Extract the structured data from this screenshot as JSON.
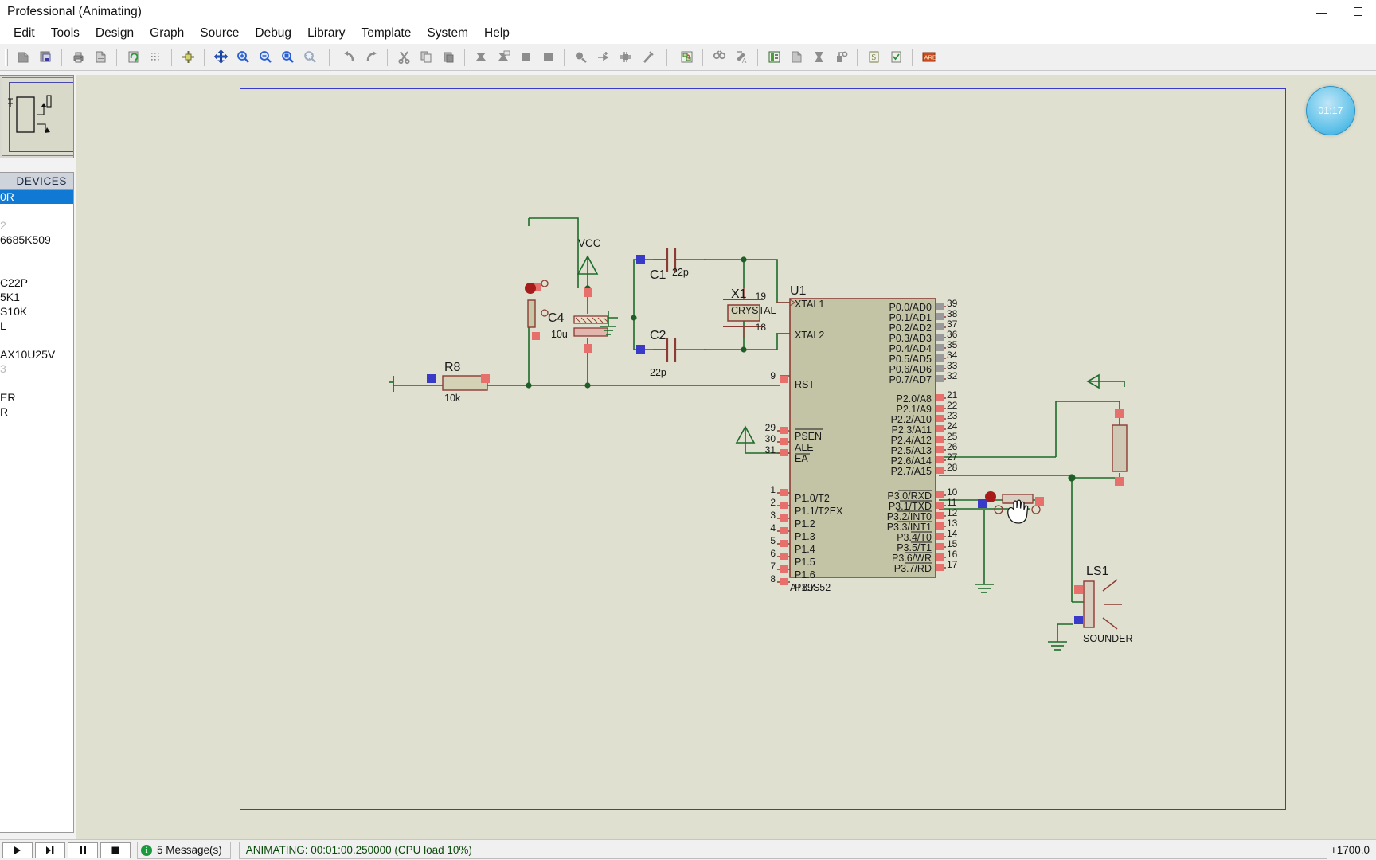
{
  "window": {
    "title": "Professional (Animating)",
    "controls": {
      "minimize": "minimize-icon",
      "maximize": "maximize-icon"
    }
  },
  "menubar": {
    "items": [
      {
        "label": "Edit"
      },
      {
        "label": "Tools"
      },
      {
        "label": "Design"
      },
      {
        "label": "Graph"
      },
      {
        "label": "Source"
      },
      {
        "label": "Debug"
      },
      {
        "label": "Library"
      },
      {
        "label": "Template"
      },
      {
        "label": "System"
      },
      {
        "label": "Help"
      }
    ]
  },
  "toolbar": {
    "groups": [
      [
        "new-sheet-icon",
        "open-design-icon"
      ],
      [
        "print-icon",
        "print-area-icon"
      ],
      [
        "refresh-display-icon",
        "toggle-grid-icon"
      ],
      [
        "origin-icon"
      ],
      [
        "pan-icon",
        "zoom-in-icon",
        "zoom-out-icon",
        "zoom-area-icon",
        "zoom-sheet-icon"
      ],
      [
        "undo-icon",
        "redo-icon"
      ],
      [
        "cut-icon",
        "copy-icon",
        "paste-icon"
      ],
      [
        "block-copy-icon",
        "block-move-icon",
        "block-rotate-icon",
        "block-delete-icon"
      ],
      [
        "pick-device-icon",
        "make-device-icon",
        "packaging-tool-icon",
        "decompose-icon"
      ],
      [
        "wire-autorouter-icon"
      ],
      [
        "search-tag-icon",
        "property-assignment-icon"
      ],
      [
        "design-explorer-icon",
        "new-sheet-hier-icon",
        "remove-sheet-icon",
        "exit-sheet-icon"
      ],
      [
        "bill-of-materials-icon",
        "electrical-rule-check-icon"
      ],
      [
        "netlist-to-ares-icon"
      ]
    ]
  },
  "sidebar": {
    "overview": {
      "title": "overview-panel"
    },
    "devices": {
      "header": "DEVICES",
      "items": [
        {
          "label": "0R",
          "selected": true,
          "faint": false
        },
        {
          "label": "",
          "spacer": true
        },
        {
          "label": "2",
          "faint": true
        },
        {
          "label": "6685K509",
          "faint": false
        },
        {
          "label": "",
          "faint": true
        },
        {
          "label": "",
          "spacer": true
        },
        {
          "label": "C22P",
          "faint": false
        },
        {
          "label": "5K1",
          "faint": false
        },
        {
          "label": "S10K",
          "faint": false
        },
        {
          "label": "L",
          "faint": false
        },
        {
          "label": "",
          "spacer": true
        },
        {
          "label": "AX10U25V",
          "faint": false
        },
        {
          "label": "3",
          "faint": true
        },
        {
          "label": "",
          "spacer": true
        },
        {
          "label": "ER",
          "faint": false
        },
        {
          "label": "R",
          "faint": false
        }
      ]
    }
  },
  "canvas": {
    "simulation_clock": "01:17"
  },
  "schematic": {
    "power_labels": [
      {
        "name": "vcc-label",
        "text": "VCC"
      }
    ],
    "components": [
      {
        "ref": "R8",
        "value": "10k",
        "name": "resistor-r8"
      },
      {
        "ref": "C4",
        "value": "10u",
        "name": "capacitor-c4"
      },
      {
        "ref": "C1",
        "value": "22p",
        "name": "capacitor-c1"
      },
      {
        "ref": "C2",
        "value": "22p",
        "name": "capacitor-c2"
      },
      {
        "ref": "X1",
        "value": "CRYSTAL",
        "name": "crystal-x1"
      },
      {
        "ref": "U1",
        "value": "AT89S52",
        "name": "mcu-u1"
      },
      {
        "ref": "LS1",
        "value": "SOUNDER",
        "name": "sounder-ls1"
      }
    ],
    "mcu": {
      "ref": "U1",
      "part": "AT89S52",
      "left_pins": [
        {
          "num": "19",
          "label": "XTAL1"
        },
        {
          "num": "18",
          "label": "XTAL2"
        },
        {
          "num": "9",
          "label": "RST"
        },
        {
          "num": "29",
          "label": "PSEN"
        },
        {
          "num": "30",
          "label": "ALE"
        },
        {
          "num": "31",
          "label": "EA"
        },
        {
          "num": "1",
          "label": "P1.0/T2"
        },
        {
          "num": "2",
          "label": "P1.1/T2EX"
        },
        {
          "num": "3",
          "label": "P1.2"
        },
        {
          "num": "4",
          "label": "P1.3"
        },
        {
          "num": "5",
          "label": "P1.4"
        },
        {
          "num": "6",
          "label": "P1.5"
        },
        {
          "num": "7",
          "label": "P1.6"
        },
        {
          "num": "8",
          "label": "P1.7"
        }
      ],
      "right_pins_p0": [
        {
          "num": "39",
          "label": "P0.0/AD0"
        },
        {
          "num": "38",
          "label": "P0.1/AD1"
        },
        {
          "num": "37",
          "label": "P0.2/AD2"
        },
        {
          "num": "36",
          "label": "P0.3/AD3"
        },
        {
          "num": "35",
          "label": "P0.4/AD4"
        },
        {
          "num": "34",
          "label": "P0.5/AD5"
        },
        {
          "num": "33",
          "label": "P0.6/AD6"
        },
        {
          "num": "32",
          "label": "P0.7/AD7"
        }
      ],
      "right_pins_p2": [
        {
          "num": "21",
          "label": "P2.0/A8"
        },
        {
          "num": "22",
          "label": "P2.1/A9"
        },
        {
          "num": "23",
          "label": "P2.2/A10"
        },
        {
          "num": "24",
          "label": "P2.3/A11"
        },
        {
          "num": "25",
          "label": "P2.4/A12"
        },
        {
          "num": "26",
          "label": "P2.5/A13"
        },
        {
          "num": "27",
          "label": "P2.6/A14"
        },
        {
          "num": "28",
          "label": "P2.7/A15"
        }
      ],
      "right_pins_p3": [
        {
          "num": "10",
          "label": "P3.0/RXD"
        },
        {
          "num": "11",
          "label": "P3.1/TXD"
        },
        {
          "num": "12",
          "label": "P3.2/INT0"
        },
        {
          "num": "13",
          "label": "P3.3/INT1"
        },
        {
          "num": "14",
          "label": "P3.4/T0"
        },
        {
          "num": "15",
          "label": "P3.5/T1"
        },
        {
          "num": "16",
          "label": "P3.6/WR"
        },
        {
          "num": "17",
          "label": "P3.7/RD"
        }
      ]
    },
    "colors": {
      "canvas_bg": "#dfe0cf",
      "wire": "#1d6b2a",
      "body_outline": "#8c3b34",
      "body_fill": "#c3c4a5",
      "pin_red": "#e06a6a",
      "pin_blue": "#3a3ac8",
      "sheet_border": "#3a3ad0",
      "text": "#1a1a1a"
    }
  },
  "statusbar": {
    "buttons": [
      {
        "name": "sim-play-button",
        "glyph": "▶"
      },
      {
        "name": "sim-step-button",
        "glyph": "▶❙"
      },
      {
        "name": "sim-pause-button",
        "glyph": "❙❙"
      },
      {
        "name": "sim-stop-button",
        "glyph": "■"
      }
    ],
    "messages": "5 Message(s)",
    "animating": "ANIMATING: 00:01:00.250000 (CPU load 10%)",
    "coordinates": "+1700.0"
  }
}
